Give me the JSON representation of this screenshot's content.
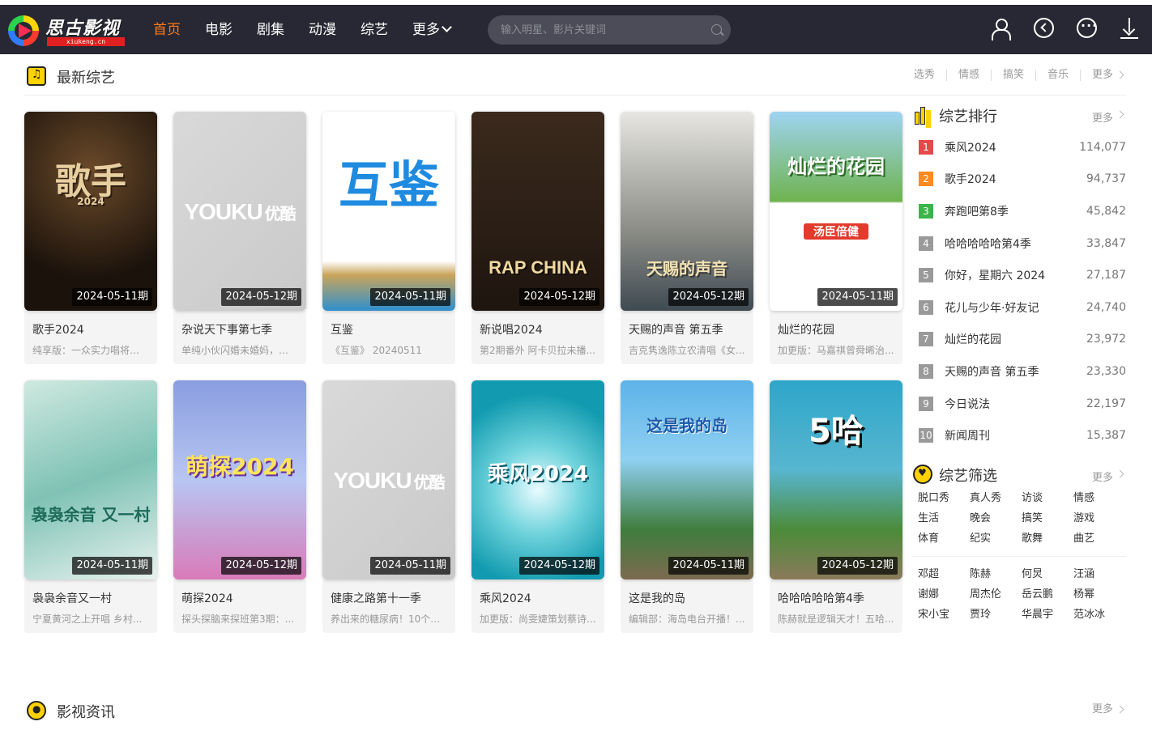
{
  "header": {
    "logo_text": "思古影视",
    "logo_sub": "xiukeng.cn",
    "nav": [
      {
        "label": "首页",
        "active": true
      },
      {
        "label": "电影",
        "active": false
      },
      {
        "label": "剧集",
        "active": false
      },
      {
        "label": "动漫",
        "active": false
      },
      {
        "label": "综艺",
        "active": false
      },
      {
        "label": "更多",
        "active": false
      }
    ],
    "search_placeholder": "输入明星、影片关键词",
    "icons": [
      "user-icon",
      "history-icon",
      "chat-icon",
      "download-icon"
    ]
  },
  "latest": {
    "title": "最新综艺",
    "links": [
      "选秀",
      "情感",
      "搞笑",
      "音乐",
      "更多"
    ],
    "cards": [
      {
        "name": "歌手2024",
        "desc": "纯享版：一众实力唱将惊艳献唱",
        "badge": "2024-05-11期",
        "poster": "singer"
      },
      {
        "name": "杂说天下事第七季",
        "desc": "单纯小伙闪婚未婚妈，结果...",
        "badge": "2024-05-12期",
        "poster": "youku"
      },
      {
        "name": "互鉴",
        "desc": "《互鉴》 20240511",
        "badge": "2024-05-11期",
        "poster": "hujian"
      },
      {
        "name": "新说唱2024",
        "desc": "第2期番外 阿卡贝拉未播...",
        "badge": "2024-05-12期",
        "poster": "rap"
      },
      {
        "name": "天赐的声音 第五季",
        "desc": "吉克隽逸陈立农清唱《女...",
        "badge": "2024-05-12期",
        "poster": "voice"
      },
      {
        "name": "灿烂的花园",
        "desc": "加更版：马嘉祺曾舜晞治...",
        "badge": "2024-05-11期",
        "poster": "garden"
      },
      {
        "name": "袅袅余音又一村",
        "desc": "宁夏黄河之上开唱 乡村...",
        "badge": "2024-05-11期",
        "poster": "village"
      },
      {
        "name": "萌探2024",
        "desc": "探头探脑来探班第3期：...",
        "badge": "2024-05-12期",
        "poster": "mengtan"
      },
      {
        "name": "健康之路第十一季",
        "desc": "养出来的糖尿病！10个糖...",
        "badge": "2024-05-11期",
        "poster": "youku"
      },
      {
        "name": "乘风2024",
        "desc": "加更版：尚雯婕策划蔡诗...",
        "badge": "2024-05-12期",
        "poster": "wind"
      },
      {
        "name": "这是我的岛",
        "desc": "编辑部：海岛电台开播！...",
        "badge": "2024-05-11期",
        "poster": "island"
      },
      {
        "name": "哈哈哈哈哈第4季",
        "desc": "陈赫就是逻辑天才！五哈...",
        "badge": "2024-05-12期",
        "poster": "haha"
      }
    ]
  },
  "ranking": {
    "title": "综艺排行",
    "more": "更多",
    "items": [
      {
        "rank": "1",
        "name": "乘风2024",
        "count": "114,077",
        "color": "#e34b4b"
      },
      {
        "rank": "2",
        "name": "歌手2024",
        "count": "94,737",
        "color": "#ff8a1f"
      },
      {
        "rank": "3",
        "name": "奔跑吧第8季",
        "count": "45,842",
        "color": "#3bb54a"
      },
      {
        "rank": "4",
        "name": "哈哈哈哈哈第4季",
        "count": "33,847",
        "color": "#9a9a9a"
      },
      {
        "rank": "5",
        "name": "你好，星期六 2024",
        "count": "27,187",
        "color": "#9a9a9a"
      },
      {
        "rank": "6",
        "name": "花儿与少年·好友记",
        "count": "24,740",
        "color": "#9a9a9a"
      },
      {
        "rank": "7",
        "name": "灿烂的花园",
        "count": "23,972",
        "color": "#9a9a9a"
      },
      {
        "rank": "8",
        "name": "天赐的声音 第五季",
        "count": "23,330",
        "color": "#9a9a9a"
      },
      {
        "rank": "9",
        "name": "今日说法",
        "count": "22,197",
        "color": "#9a9a9a"
      },
      {
        "rank": "10",
        "name": "新闻周刊",
        "count": "15,387",
        "color": "#9a9a9a"
      }
    ]
  },
  "filter": {
    "title": "综艺筛选",
    "more": "更多",
    "types": [
      "脱口秀",
      "真人秀",
      "访谈",
      "情感",
      "生活",
      "晚会",
      "搞笑",
      "游戏",
      "体育",
      "纪实",
      "歌舞",
      "曲艺"
    ],
    "people": [
      "邓超",
      "陈赫",
      "何炅",
      "汪涵",
      "谢娜",
      "周杰伦",
      "岳云鹏",
      "杨幂",
      "宋小宝",
      "贾玲",
      "华晨宇",
      "范冰冰"
    ]
  },
  "news": {
    "title": "影视资讯",
    "more": "更多"
  },
  "poster_text": {
    "singer": "歌手",
    "singer_year": "2024",
    "hujian": "互鉴",
    "rap": "RAP CHINA",
    "voice": "天赐的声音",
    "garden": "灿烂的花园",
    "garden_sponsor": "汤臣倍健",
    "village": "袅袅余音 又一村",
    "mengtan": "萌探2024",
    "wind": "乘风2024",
    "island": "这是我的岛",
    "haha": "5哈",
    "youku": "YOUKU",
    "youku_cn": "优酷"
  },
  "colors": {
    "topbar": "#272833",
    "accent": "#ff7a1a",
    "icon_yellow": "#ffd200"
  }
}
